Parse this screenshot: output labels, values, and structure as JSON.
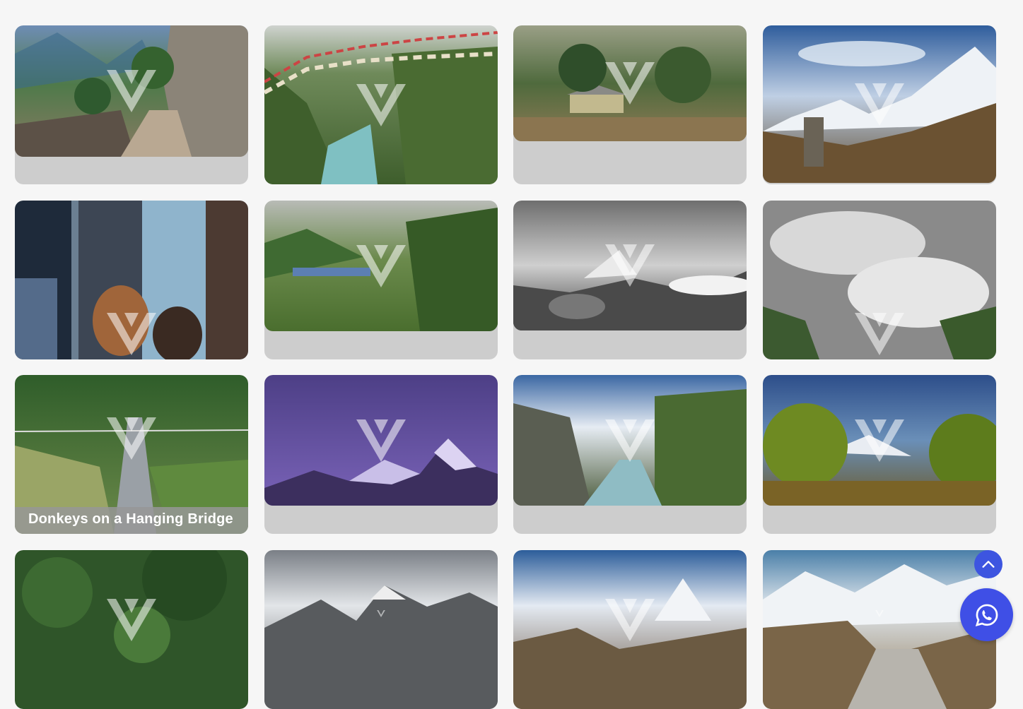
{
  "gallery": {
    "items": [
      {
        "caption": "",
        "scene": "stone-wall-trail",
        "photo": "#5f7c52"
      },
      {
        "caption": "",
        "scene": "prayer-flags-river-gorge",
        "photo": "#4c6b3c"
      },
      {
        "caption": "",
        "scene": "stone-hut-forest",
        "photo": "#6e6a4e"
      },
      {
        "caption": "",
        "scene": "chorten-mountain-valley",
        "photo": "#4a6d93"
      },
      {
        "caption": "",
        "scene": "dogs-at-gate",
        "photo": "#5c6e80"
      },
      {
        "caption": "",
        "scene": "village-valley",
        "photo": "#5e7246"
      },
      {
        "caption": "",
        "scene": "rocky-ridge-ama-dablam",
        "photo": "#4b4b4b"
      },
      {
        "caption": "",
        "scene": "cloudy-valley",
        "photo": "#8d8d8d"
      },
      {
        "caption": "Donkeys on a Hanging Bridge",
        "scene": "hanging-bridge",
        "photo": "#4f7a3e"
      },
      {
        "caption": "",
        "scene": "starry-night-peaks",
        "photo": "#5a4a8e"
      },
      {
        "caption": "",
        "scene": "river-gorge-cliffs",
        "photo": "#4e6a3e"
      },
      {
        "caption": "",
        "scene": "pine-trees-everest",
        "photo": "#6b7b2e"
      },
      {
        "caption": "",
        "scene": "forest-slope-bridge",
        "photo": "#2f5529"
      },
      {
        "caption": "",
        "scene": "cloudy-peaks-moraine",
        "photo": "#62676c"
      },
      {
        "caption": "",
        "scene": "ama-dablam-blue-sky",
        "photo": "#3d6aa0"
      },
      {
        "caption": "",
        "scene": "everest-base-camp-glacier",
        "photo": "#6e8aa3"
      }
    ]
  },
  "buttons": {
    "scroll_top": "chevron-up-icon",
    "whatsapp": "whatsapp-icon"
  },
  "colors": {
    "accent": "#3f4fe6",
    "card_background": "#cdcdcd",
    "page_background": "#f6f6f6"
  }
}
